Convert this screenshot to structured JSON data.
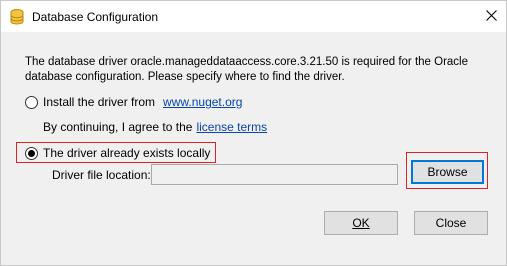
{
  "window": {
    "title": "Database Configuration",
    "icon": "database-icon",
    "close_glyph": "✕"
  },
  "description": "The database driver oracle.manageddataaccess.core.3.21.50 is required for the Oracle database configuration. Please specify where to find the driver.",
  "options": {
    "install": {
      "label": "Install the driver from",
      "link": "www.nuget.org",
      "checked": false
    },
    "agreement": {
      "prefix": "By continuing, I agree to the",
      "link": "license terms"
    },
    "local": {
      "label": "The driver already exists locally",
      "checked": true
    }
  },
  "driver_location": {
    "label": "Driver file location:",
    "value": ""
  },
  "buttons": {
    "browse": "Browse",
    "ok": "OK",
    "close": "Close"
  },
  "colors": {
    "highlight": "#d9232a",
    "link": "#0645ad",
    "accent": "#0078d7"
  }
}
